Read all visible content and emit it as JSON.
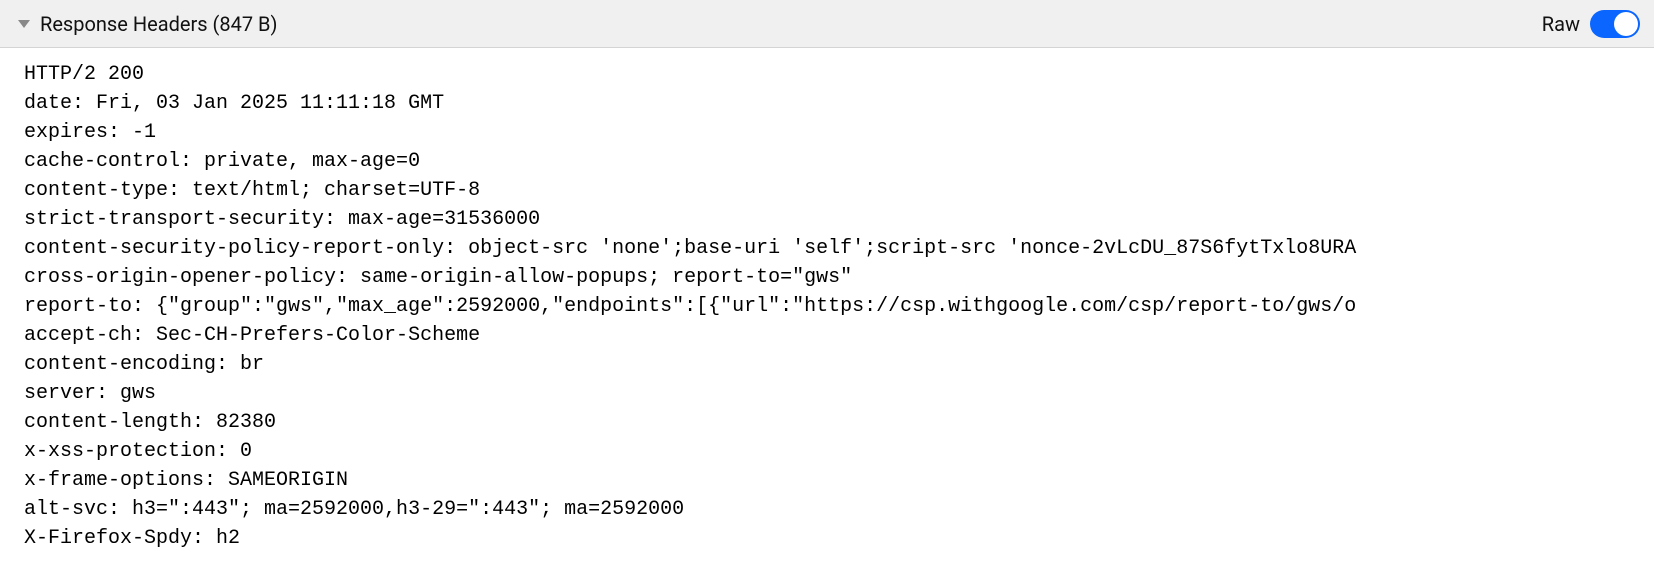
{
  "header": {
    "title": "Response Headers (847 B)",
    "raw_label": "Raw",
    "raw_on": true
  },
  "lines": [
    "HTTP/2 200",
    "date: Fri, 03 Jan 2025 11:11:18 GMT",
    "expires: -1",
    "cache-control: private, max-age=0",
    "content-type: text/html; charset=UTF-8",
    "strict-transport-security: max-age=31536000",
    "content-security-policy-report-only: object-src 'none';base-uri 'self';script-src 'nonce-2vLcDU_87S6fytTxlo8URA",
    "cross-origin-opener-policy: same-origin-allow-popups; report-to=\"gws\"",
    "report-to: {\"group\":\"gws\",\"max_age\":2592000,\"endpoints\":[{\"url\":\"https://csp.withgoogle.com/csp/report-to/gws/o",
    "accept-ch: Sec-CH-Prefers-Color-Scheme",
    "content-encoding: br",
    "server: gws",
    "content-length: 82380",
    "x-xss-protection: 0",
    "x-frame-options: SAMEORIGIN",
    "alt-svc: h3=\":443\"; ma=2592000,h3-29=\":443\"; ma=2592000",
    "X-Firefox-Spdy: h2"
  ]
}
